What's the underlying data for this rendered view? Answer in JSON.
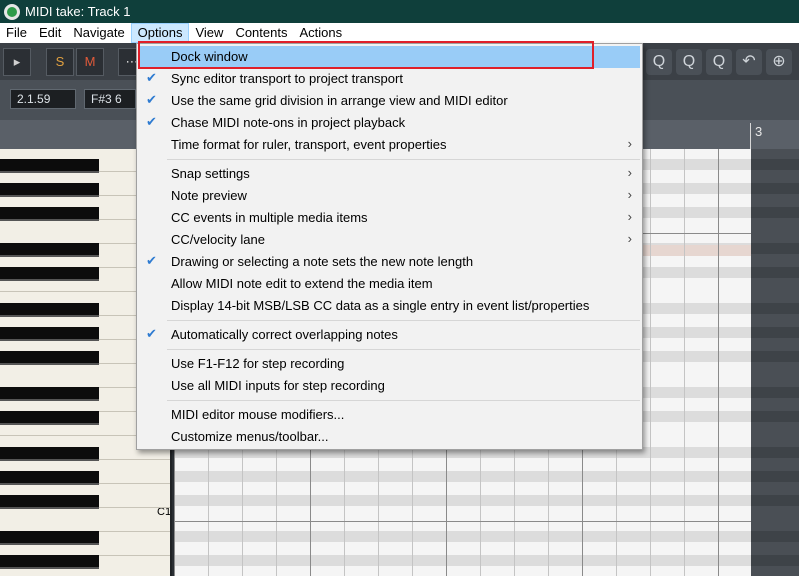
{
  "window": {
    "title": "MIDI take: Track 1"
  },
  "menubar": {
    "items": [
      "File",
      "Edit",
      "Navigate",
      "Options",
      "View",
      "Contents",
      "Actions"
    ]
  },
  "toolbar": {
    "solo_label": "S",
    "mute_label": "M",
    "icons": [
      "play-icon",
      "zoom-icon",
      "zoom-icon",
      "zoom-icon",
      "undo-icon",
      "zoom-fit-icon"
    ]
  },
  "position": {
    "time": "2.1.59",
    "note": "F#3 6"
  },
  "ruler": {
    "bar_label": "3"
  },
  "piano": {
    "c1_label": "C1"
  },
  "options_menu": {
    "items": [
      {
        "label": "Dock window",
        "checked": false,
        "submenu": false,
        "selected": true
      },
      {
        "label": "Sync editor transport to project transport",
        "checked": true,
        "submenu": false
      },
      {
        "label": "Use the same grid division in arrange view and MIDI editor",
        "checked": true,
        "submenu": false
      },
      {
        "label": "Chase MIDI note-ons in project playback",
        "checked": true,
        "submenu": false
      },
      {
        "label": "Time format for ruler, transport, event properties",
        "checked": false,
        "submenu": true
      },
      {
        "label": "Snap settings",
        "checked": false,
        "submenu": true
      },
      {
        "label": "Note preview",
        "checked": false,
        "submenu": true
      },
      {
        "label": "CC events in multiple media items",
        "checked": false,
        "submenu": true
      },
      {
        "label": "CC/velocity lane",
        "checked": false,
        "submenu": true
      },
      {
        "label": "Drawing or selecting a note sets the new note length",
        "checked": true,
        "submenu": false
      },
      {
        "label": "Allow MIDI note edit to extend the media item",
        "checked": false,
        "submenu": false
      },
      {
        "label": "Display 14-bit MSB/LSB CC data as a single entry in event list/properties",
        "checked": false,
        "submenu": false
      },
      {
        "label": "Automatically correct overlapping notes",
        "checked": true,
        "submenu": false
      },
      {
        "label": "Use F1-F12 for step recording",
        "checked": false,
        "submenu": false
      },
      {
        "label": "Use all MIDI inputs for step recording",
        "checked": false,
        "submenu": false
      },
      {
        "label": "MIDI editor mouse modifiers...",
        "checked": false,
        "submenu": false
      },
      {
        "label": "Customize menus/toolbar...",
        "checked": false,
        "submenu": false
      }
    ],
    "checkmark": "✔",
    "submenu_arrow": "›"
  }
}
